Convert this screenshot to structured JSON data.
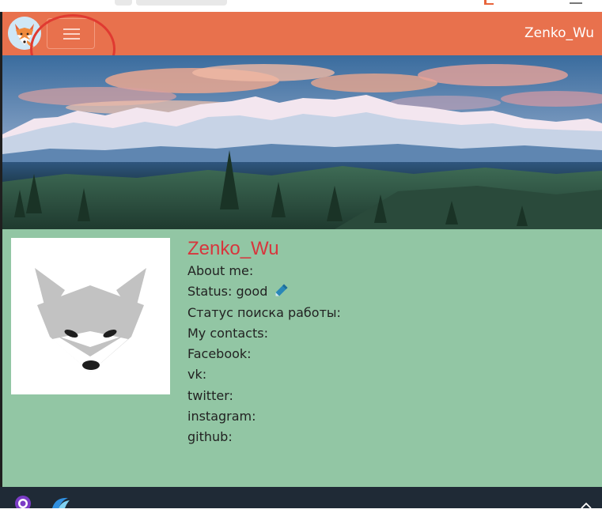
{
  "header": {
    "username": "Zenko_Wu",
    "menu_icon": "hamburger-menu-icon",
    "logo_icon": "fox-logo-icon",
    "background_color": "#e8714d"
  },
  "profile": {
    "name": "Zenko_Wu",
    "name_color": "#d7363d",
    "background_color": "#92c6a4",
    "about_me_label": "About me:",
    "status_label": "Status:",
    "status_value": "good",
    "status_edit_icon": "pencil-icon",
    "job_search_label": "Статус поиска работы:",
    "contacts_label": "My contacts:",
    "contacts": [
      {
        "label": "Facebook:"
      },
      {
        "label": "vk:"
      },
      {
        "label": "twitter:"
      },
      {
        "label": "instagram:"
      },
      {
        "label": "github:"
      }
    ],
    "avatar_icon": "fox-avatar-icon"
  },
  "banner": {
    "image": "mountain-landscape"
  },
  "taskbar": {
    "icons": [
      "github-icon",
      "edge-icon",
      "chevron-up-icon"
    ]
  }
}
